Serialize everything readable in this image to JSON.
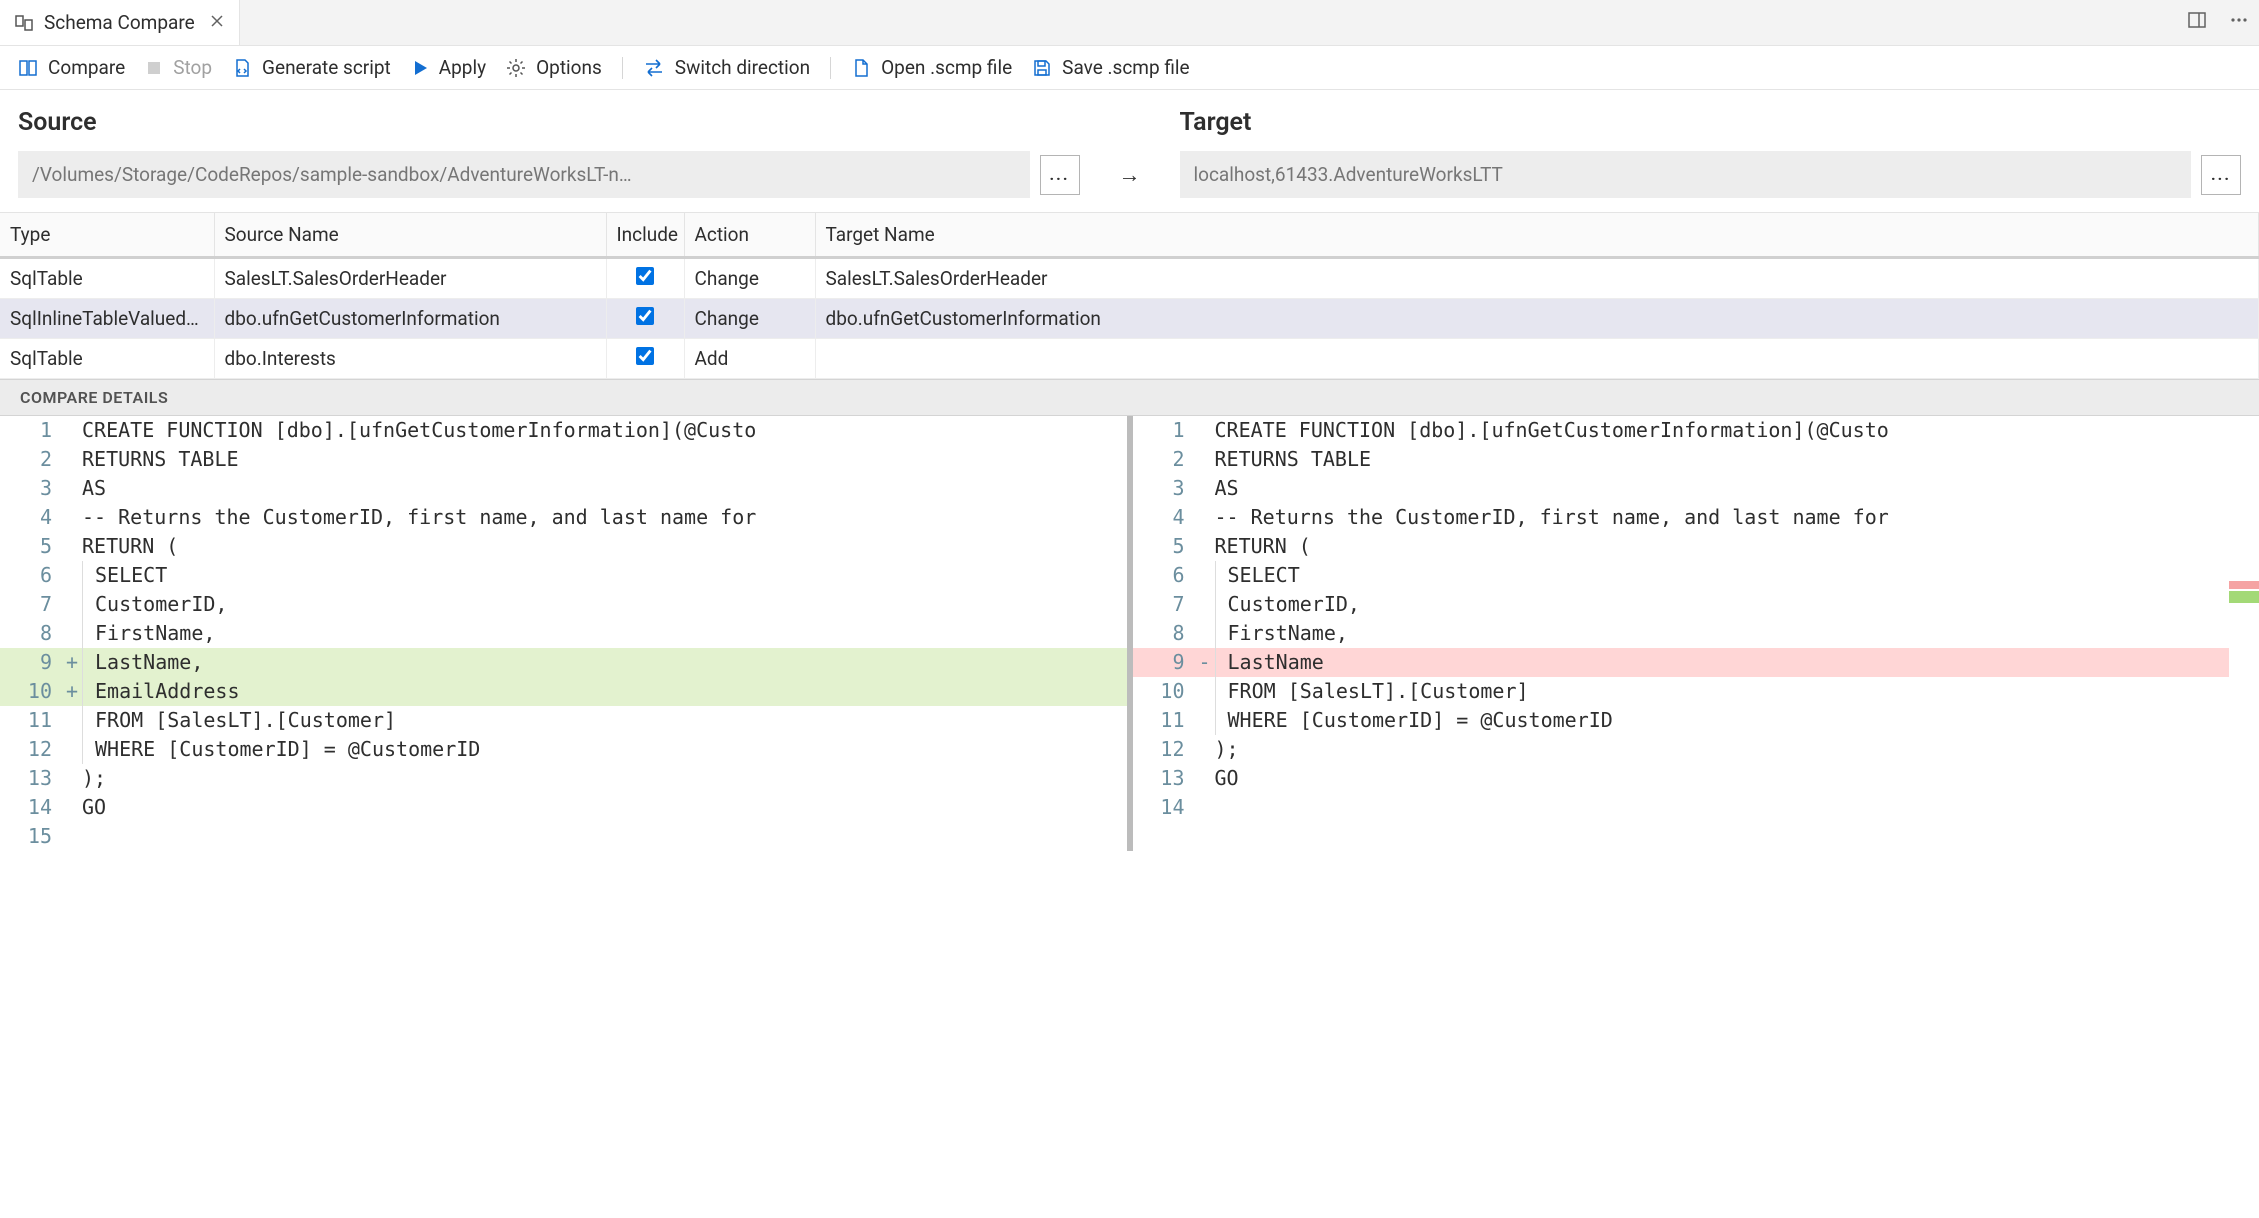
{
  "tab": {
    "title": "Schema Compare"
  },
  "toolbar": {
    "compare": "Compare",
    "stop": "Stop",
    "generate": "Generate script",
    "apply": "Apply",
    "options": "Options",
    "switch": "Switch direction",
    "open": "Open .scmp file",
    "save": "Save .scmp file"
  },
  "headers": {
    "source": "Source",
    "target": "Target",
    "source_path": "/Volumes/Storage/CodeRepos/sample-sandbox/AdventureWorksLT-n…",
    "target_path": "localhost,61433.AdventureWorksLTT",
    "arrow": "→",
    "ellipsis": "..."
  },
  "table": {
    "cols": {
      "type": "Type",
      "source": "Source Name",
      "include": "Include",
      "action": "Action",
      "target": "Target Name"
    },
    "rows": [
      {
        "type": "SqlTable",
        "src": "SalesLT.SalesOrderHeader",
        "include": true,
        "action": "Change",
        "tgt": "SalesLT.SalesOrderHeader",
        "selected": false
      },
      {
        "type": "SqlInlineTableValuedFu…",
        "src": "dbo.ufnGetCustomerInformation",
        "include": true,
        "action": "Change",
        "tgt": "dbo.ufnGetCustomerInformation",
        "selected": true
      },
      {
        "type": "SqlTable",
        "src": "dbo.Interests",
        "include": true,
        "action": "Add",
        "tgt": "",
        "selected": false
      }
    ]
  },
  "details_label": "COMPARE DETAILS",
  "diff": {
    "left": [
      {
        "n": "1",
        "s": "",
        "t": "CREATE FUNCTION [dbo].[ufnGetCustomerInformation](@Custo",
        "cls": ""
      },
      {
        "n": "2",
        "s": "",
        "t": "RETURNS TABLE",
        "cls": ""
      },
      {
        "n": "3",
        "s": "",
        "t": "AS",
        "cls": ""
      },
      {
        "n": "4",
        "s": "",
        "t": "-- Returns the CustomerID, first name, and last name for",
        "cls": ""
      },
      {
        "n": "5",
        "s": "",
        "t": "RETURN (",
        "cls": ""
      },
      {
        "n": "6",
        "s": "",
        "t": "SELECT",
        "cls": "",
        "indent": true
      },
      {
        "n": "7",
        "s": "",
        "t": "CustomerID,",
        "cls": "",
        "indent": true
      },
      {
        "n": "8",
        "s": "",
        "t": "FirstName,",
        "cls": "",
        "indent": true
      },
      {
        "n": "9",
        "s": "+",
        "t": "LastName,",
        "cls": "add",
        "indent": true
      },
      {
        "n": "10",
        "s": "+",
        "t": "EmailAddress",
        "cls": "add",
        "indent": true
      },
      {
        "n": "11",
        "s": "",
        "t": "FROM [SalesLT].[Customer]",
        "cls": "",
        "indent": true
      },
      {
        "n": "12",
        "s": "",
        "t": "WHERE [CustomerID] = @CustomerID",
        "cls": "",
        "indent": true
      },
      {
        "n": "13",
        "s": "",
        "t": ");",
        "cls": ""
      },
      {
        "n": "14",
        "s": "",
        "t": "GO",
        "cls": ""
      },
      {
        "n": "15",
        "s": "",
        "t": "",
        "cls": ""
      }
    ],
    "right": [
      {
        "n": "1",
        "s": "",
        "t": "CREATE FUNCTION [dbo].[ufnGetCustomerInformation](@Custo",
        "cls": ""
      },
      {
        "n": "2",
        "s": "",
        "t": "RETURNS TABLE",
        "cls": ""
      },
      {
        "n": "3",
        "s": "",
        "t": "AS",
        "cls": ""
      },
      {
        "n": "4",
        "s": "",
        "t": "-- Returns the CustomerID, first name, and last name for",
        "cls": ""
      },
      {
        "n": "5",
        "s": "",
        "t": "RETURN (",
        "cls": ""
      },
      {
        "n": "6",
        "s": "",
        "t": "SELECT",
        "cls": "",
        "indent": true
      },
      {
        "n": "7",
        "s": "",
        "t": "CustomerID,",
        "cls": "",
        "indent": true
      },
      {
        "n": "8",
        "s": "",
        "t": "FirstName,",
        "cls": "",
        "indent": true
      },
      {
        "n": "9",
        "s": "-",
        "t": "LastName",
        "cls": "del",
        "indent": true
      },
      {
        "n": "",
        "s": "",
        "t": "",
        "cls": "hatch"
      },
      {
        "n": "10",
        "s": "",
        "t": "FROM [SalesLT].[Customer]",
        "cls": "",
        "indent": true
      },
      {
        "n": "11",
        "s": "",
        "t": "WHERE [CustomerID] = @CustomerID",
        "cls": "",
        "indent": true
      },
      {
        "n": "12",
        "s": "",
        "t": ");",
        "cls": ""
      },
      {
        "n": "13",
        "s": "",
        "t": "GO",
        "cls": ""
      },
      {
        "n": "14",
        "s": "",
        "t": "",
        "cls": ""
      }
    ]
  }
}
